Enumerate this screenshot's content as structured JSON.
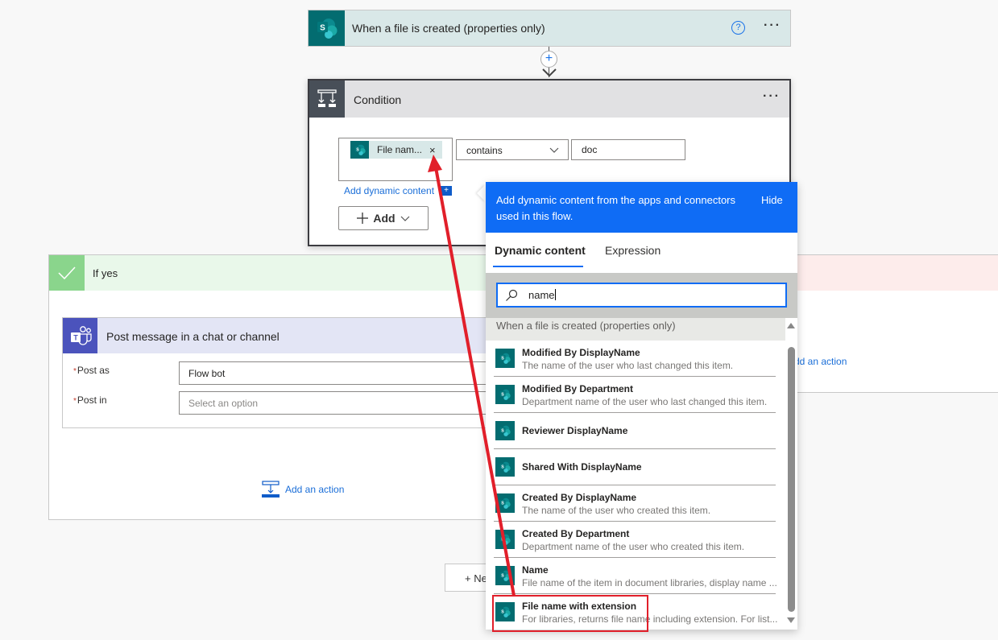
{
  "trigger": {
    "title": "When a file is created (properties only)",
    "help_icon": "question-circle-icon",
    "more_icon": "ellipsis-icon",
    "more_label": "···"
  },
  "connector": {
    "add_label": "+"
  },
  "condition": {
    "title": "Condition",
    "more_label": "···",
    "left_token": "File nam...",
    "token_remove": "×",
    "operator": "contains",
    "value": "doc",
    "add_dynamic_label": "Add dynamic content",
    "add_dynamic_plus": "+",
    "add_button": "Add"
  },
  "if_yes": {
    "title": "If yes",
    "add_action_label": "Add an action"
  },
  "if_no": {
    "add_action_label": "dd an action"
  },
  "teams_action": {
    "title": "Post message in a chat or channel",
    "fields": [
      {
        "label": "Post as",
        "required": "*",
        "value": "Flow bot",
        "placeholder": ""
      },
      {
        "label": "Post in",
        "required": "*",
        "value": "",
        "placeholder": "Select an option"
      }
    ]
  },
  "new_step": {
    "label": "+ Ne"
  },
  "dynamic_panel": {
    "header_message": "Add dynamic content from the apps and connectors used in this flow.",
    "hide_label": "Hide",
    "tabs": [
      {
        "label": "Dynamic content",
        "active": true
      },
      {
        "label": "Expression",
        "active": false
      }
    ],
    "search_value": "name",
    "group_title": "When a file is created (properties only)",
    "items": [
      {
        "name": "Modified By DisplayName",
        "description": "The name of the user who last changed this item."
      },
      {
        "name": "Modified By Department",
        "description": "Department name of the user who last changed this item."
      },
      {
        "name": "Reviewer DisplayName",
        "description": ""
      },
      {
        "name": "Shared With DisplayName",
        "description": ""
      },
      {
        "name": "Created By DisplayName",
        "description": "The name of the user who created this item."
      },
      {
        "name": "Created By Department",
        "description": "Department name of the user who created this item."
      },
      {
        "name": "Name",
        "description": "File name of the item in document libraries, display name ..."
      },
      {
        "name": "File name with extension",
        "description": "For libraries, returns file name including extension. For list...",
        "highlighted": true
      }
    ]
  },
  "colors": {
    "accent_blue": "#0f6cf5",
    "sharepoint_teal": "#036c70",
    "teams_purple": "#4b53bc",
    "condition_dark": "#484f58",
    "yes_green": "#8ad58c",
    "no_red_bg": "#fdeceb",
    "annotation_red": "#e11f2a"
  }
}
